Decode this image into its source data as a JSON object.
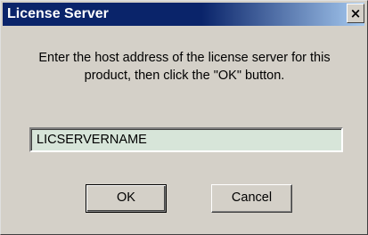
{
  "window": {
    "title": "License Server",
    "close_glyph": "×",
    "title_bar_colors": [
      "#0a246a",
      "#a6caf0"
    ],
    "face_color": "#d4d0c8"
  },
  "message": {
    "line1": "Enter the host address of the license server for this",
    "line2": "product, then click the \"OK\" button."
  },
  "host_input": {
    "value": "LICSERVERNAME",
    "background": "#d7e5d9"
  },
  "buttons": {
    "ok_label": "OK",
    "cancel_label": "Cancel"
  },
  "icons": {
    "close": "close-icon"
  }
}
